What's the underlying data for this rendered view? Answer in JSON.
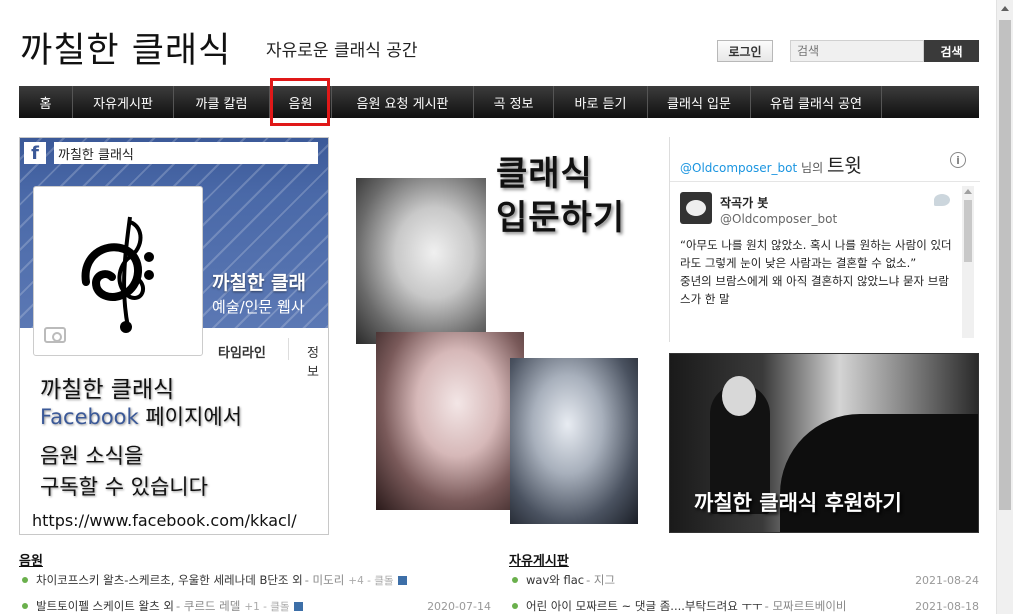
{
  "header": {
    "site_title": "까칠한 클래식",
    "site_subtitle": "자유로운 클래식 공간",
    "login_label": "로그인",
    "search_placeholder": "검색",
    "search_button_label": "검색"
  },
  "nav": {
    "items": [
      {
        "label": "홈"
      },
      {
        "label": "자유게시판"
      },
      {
        "label": "까클 칼럼"
      },
      {
        "label": "음원"
      },
      {
        "label": "음원 요청 게시판"
      },
      {
        "label": "곡 정보"
      },
      {
        "label": "바로 듣기"
      },
      {
        "label": "클래식 입문"
      },
      {
        "label": "유럽 클래식 공연"
      }
    ],
    "highlight_color": "#e01818"
  },
  "facebook": {
    "logo_icon": "facebook-f-icon",
    "page_name": "까칠한 클래식",
    "cover_title": "까칠한 클래",
    "cover_category": "예술/인문 웹사",
    "tab_timeline": "타임라인",
    "tab_info": "정보",
    "promo_line1": "까칠한 클래식",
    "promo_fb_word": "Facebook",
    "promo_line2_rest": " 페이지에서",
    "promo_line3": "음원 소식을",
    "promo_line4": "구독할 수 있습니다",
    "url": "https://www.facebook.com/kkacl/"
  },
  "intro": {
    "title_line1": "클래식",
    "title_line2": "입문하기"
  },
  "twitter": {
    "handle": "@Oldcomposer_bot",
    "nim": " 님의 ",
    "word": "트윗",
    "info_icon": "i",
    "author_name": "작곡가 봇",
    "author_screenname": "@Oldcomposer_bot",
    "tweet_text": "“아무도 나를 원치 않았소. 혹시 나를 원하는 사람이 있더라도 그렇게 눈이 낮은 사람과는 결혼할 수 없소.”",
    "tweet_text2": "중년의 브람스에게 왜 아직 결혼하지 않았느냐 묻자 브람스가 한 말"
  },
  "support": {
    "text": "까칠한 클래식 후원하기"
  },
  "lists": {
    "left": {
      "heading": "음원",
      "rows": [
        {
          "title": "차이코프스키 왈츠-스케르초, 우울한 세레나데 B단조 외",
          "author": " - 미도리",
          "count": "+4 - 클돌",
          "date": ""
        },
        {
          "title": "발트토이펠 스케이트 왈츠 외",
          "author": " - 쿠르드 레델",
          "count": "+1 - 클돌",
          "date": "2020-07-14"
        }
      ]
    },
    "right": {
      "heading": "자유게시판",
      "rows": [
        {
          "title": "wav와 flac",
          "author": " - 지그",
          "count": "",
          "date": "2021-08-24"
        },
        {
          "title": "어린 아이 모짜르트 ~ 댓글 좀....부탁드려요 ㅜㅜ",
          "author": " - 모짜르트베이비",
          "count": "",
          "date": "2021-08-18"
        }
      ]
    }
  }
}
